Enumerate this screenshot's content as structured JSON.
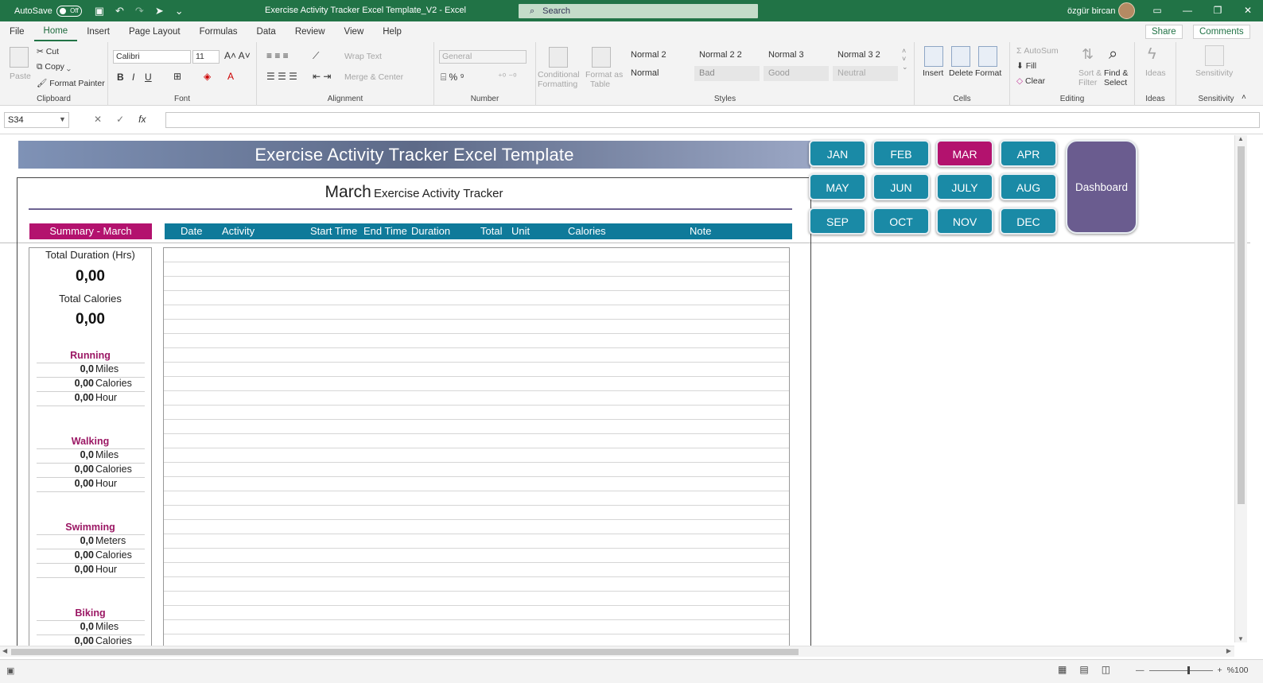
{
  "titlebar": {
    "autosave_label": "AutoSave",
    "autosave_state": "Off",
    "doc_title": "Exercise Activity Tracker Excel Template_V2  -  Excel",
    "search_placeholder": "Search",
    "user_name": "özgür bircan"
  },
  "menu": {
    "tabs": [
      "File",
      "Home",
      "Insert",
      "Page Layout",
      "Formulas",
      "Data",
      "Review",
      "View",
      "Help"
    ],
    "active_tab": "Home",
    "share": "Share",
    "comments": "Comments"
  },
  "ribbon": {
    "clipboard": {
      "label": "Clipboard",
      "paste": "Paste",
      "cut": "Cut",
      "copy": "Copy",
      "format_painter": "Format Painter"
    },
    "font": {
      "label": "Font",
      "font_name": "Calibri",
      "font_size": "11"
    },
    "alignment": {
      "label": "Alignment",
      "wrap_text": "Wrap Text",
      "merge_center": "Merge & Center"
    },
    "number": {
      "label": "Number",
      "format": "General"
    },
    "styles": {
      "label": "Styles",
      "conditional": "Conditional",
      "formatting": "Formatting",
      "format_as": "Format as",
      "table": "Table",
      "cells": [
        "Normal 2",
        "Normal 2 2",
        "Normal 3",
        "Normal 3 2",
        "Normal",
        "Bad",
        "Good",
        "Neutral"
      ]
    },
    "cells": {
      "label": "Cells",
      "insert": "Insert",
      "delete": "Delete",
      "format": "Format"
    },
    "editing": {
      "label": "Editing",
      "autosum": "AutoSum",
      "fill": "Fill",
      "clear": "Clear",
      "sort": "Sort &",
      "filter": "Filter",
      "find": "Find &",
      "select": "Select"
    },
    "ideas": {
      "label": "Ideas",
      "button": "Ideas"
    },
    "sensitivity": {
      "label": "Sensitivity",
      "button": "Sensitivity"
    }
  },
  "formula_bar": {
    "name_box": "S34",
    "fx": "fx",
    "value": ""
  },
  "sheet": {
    "banner_title": "Exercise Activity Tracker Excel Template",
    "tracker_month": "March",
    "tracker_title": "Exercise Activity Tracker",
    "summary_header": "Summary - March",
    "table_columns": [
      "Date",
      "Activity",
      "Start Time",
      "End Time",
      "Duration",
      "Total",
      "Unit",
      "Calories",
      "Note"
    ],
    "total_duration_label": "Total Duration (Hrs)",
    "total_duration_value": "0,00",
    "total_calories_label": "Total Calories",
    "total_calories_value": "0,00",
    "activities": [
      {
        "name": "Running",
        "rows": [
          {
            "value": "0,0",
            "unit": "Miles"
          },
          {
            "value": "0,00",
            "unit": "Calories"
          },
          {
            "value": "0,00",
            "unit": "Hour"
          }
        ]
      },
      {
        "name": "Walking",
        "rows": [
          {
            "value": "0,0",
            "unit": "Miles"
          },
          {
            "value": "0,00",
            "unit": "Calories"
          },
          {
            "value": "0,00",
            "unit": "Hour"
          }
        ]
      },
      {
        "name": "Swimming",
        "rows": [
          {
            "value": "0,0",
            "unit": "Meters"
          },
          {
            "value": "0,00",
            "unit": "Calories"
          },
          {
            "value": "0,00",
            "unit": "Hour"
          }
        ]
      },
      {
        "name": "Biking",
        "rows": [
          {
            "value": "0,0",
            "unit": "Miles"
          },
          {
            "value": "0,00",
            "unit": "Calories"
          }
        ]
      }
    ],
    "months": [
      "JAN",
      "FEB",
      "MAR",
      "APR",
      "MAY",
      "JUN",
      "JULY",
      "AUG",
      "SEP",
      "OCT",
      "NOV",
      "DEC"
    ],
    "active_month": "MAR",
    "dashboard": "Dashboard"
  },
  "status": {
    "zoom": "%100"
  },
  "colors": {
    "excel_green": "#217346",
    "magenta": "#b3126e",
    "teal": "#1a8aa6",
    "purple": "#6a5c8f"
  }
}
